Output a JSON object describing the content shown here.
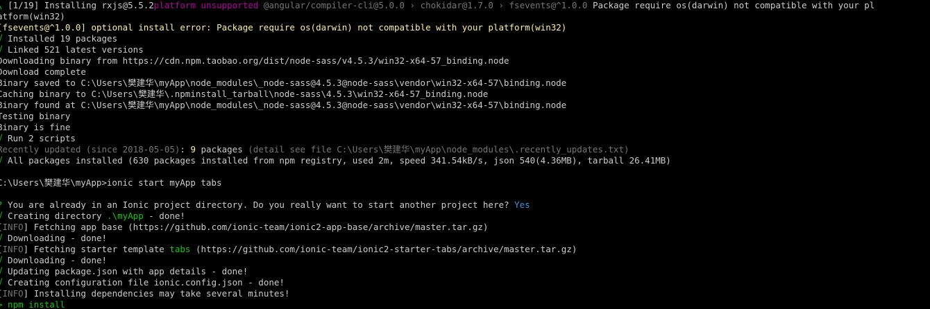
{
  "terminal": {
    "colors": {
      "background": "#000000",
      "default": "#cccccc",
      "green": "#16c60c",
      "yellow": "#f9f1a5",
      "magenta": "#b4009e",
      "gray": "#767676",
      "cyan": "#3a96dd",
      "white": "#f2f2f2"
    },
    "lines": [
      [
        {
          "t": "\\ ",
          "c": "green"
        },
        {
          "t": "[1/19] Installing rxjs@5.5.2",
          "c": "default"
        },
        {
          "t": "platform unsupported",
          "c": "magenta"
        },
        {
          "t": " @angular/compiler-cli@5.0.0 › chokidar@1.7.0 › fsevents@^1.0.0",
          "c": "gray"
        },
        {
          "t": " Package require os(darwin) not compatible with your pl",
          "c": "default"
        }
      ],
      [
        {
          "t": "atform(win32)",
          "c": "default"
        }
      ],
      [
        {
          "t": "[fsevents@^1.0.0] optional install error: Package require os(darwin) not compatible with your platform(win32)",
          "c": "yellow"
        }
      ],
      [
        {
          "t": "√",
          "c": "green"
        },
        {
          "t": " Installed 19 packages",
          "c": "default"
        }
      ],
      [
        {
          "t": "√",
          "c": "green"
        },
        {
          "t": " Linked 521 latest versions",
          "c": "default"
        }
      ],
      [
        {
          "t": "Downloading binary from https://cdn.npm.taobao.org/dist/node-sass/v4.5.3/win32-x64-57_binding.node",
          "c": "default"
        }
      ],
      [
        {
          "t": "Download complete",
          "c": "default"
        }
      ],
      [
        {
          "t": "Binary saved to C:\\Users\\樊建华\\myApp\\node_modules\\_node-sass@4.5.3@node-sass\\vendor\\win32-x64-57\\binding.node",
          "c": "default"
        }
      ],
      [
        {
          "t": "Caching binary to C:\\Users\\樊建华\\.npminstall_tarball\\node-sass\\4.5.3\\win32-x64-57_binding.node",
          "c": "default"
        }
      ],
      [
        {
          "t": "Binary found at C:\\Users\\樊建华\\myApp\\node_modules\\_node-sass@4.5.3@node-sass\\vendor\\win32-x64-57\\binding.node",
          "c": "default"
        }
      ],
      [
        {
          "t": "Testing binary",
          "c": "default"
        }
      ],
      [
        {
          "t": "Binary is fine",
          "c": "default"
        }
      ],
      [
        {
          "t": "√",
          "c": "green"
        },
        {
          "t": " Run 2 scripts",
          "c": "default"
        }
      ],
      [
        {
          "t": "Recently updated (since 2018-05-05)",
          "c": "gray"
        },
        {
          "t": ": ",
          "c": "default"
        },
        {
          "t": "9",
          "c": "yellow"
        },
        {
          "t": " packages ",
          "c": "default"
        },
        {
          "t": "(detail see file C:\\Users\\樊建华\\myApp\\node_modules\\.recently_updates.txt)",
          "c": "gray"
        }
      ],
      [
        {
          "t": "√",
          "c": "green"
        },
        {
          "t": " All packages installed (630 packages installed from npm registry, used 2m, speed 341.54kB/s, json 540(4.36MB), tarball 26.41MB)",
          "c": "default"
        }
      ],
      [],
      [
        {
          "t": "C:\\Users\\樊建华\\myApp>ionic start myApp tabs",
          "c": "default"
        }
      ],
      [],
      [
        {
          "t": "?",
          "c": "green"
        },
        {
          "t": " You are already in an Ionic project directory. Do you really want to start another project here? ",
          "c": "default"
        },
        {
          "t": "Yes",
          "c": "cyan"
        }
      ],
      [
        {
          "t": "√",
          "c": "green"
        },
        {
          "t": " Creating directory ",
          "c": "default"
        },
        {
          "t": ".\\myApp",
          "c": "green"
        },
        {
          "t": " - done!",
          "c": "default"
        }
      ],
      [
        {
          "t": "[",
          "c": "default"
        },
        {
          "t": "INFO",
          "c": "gray"
        },
        {
          "t": "] Fetching app base (https://github.com/ionic-team/ionic2-app-base/archive/master.tar.gz)",
          "c": "default"
        }
      ],
      [
        {
          "t": "√",
          "c": "green"
        },
        {
          "t": " Downloading - done!",
          "c": "default"
        }
      ],
      [
        {
          "t": "[",
          "c": "default"
        },
        {
          "t": "INFO",
          "c": "gray"
        },
        {
          "t": "] Fetching starter template ",
          "c": "default"
        },
        {
          "t": "tabs",
          "c": "green"
        },
        {
          "t": " (https://github.com/ionic-team/ionic2-starter-tabs/archive/master.tar.gz)",
          "c": "default"
        }
      ],
      [
        {
          "t": "√",
          "c": "green"
        },
        {
          "t": " Downloading - done!",
          "c": "default"
        }
      ],
      [
        {
          "t": "√",
          "c": "green"
        },
        {
          "t": " Updating package.json with app details - done!",
          "c": "default"
        }
      ],
      [
        {
          "t": "√",
          "c": "green"
        },
        {
          "t": " Creating configuration file ionic.config.json - done!",
          "c": "default"
        }
      ],
      [
        {
          "t": "[",
          "c": "default"
        },
        {
          "t": "INFO",
          "c": "gray"
        },
        {
          "t": "] Installing dependencies may take several minutes!",
          "c": "default"
        }
      ],
      [
        {
          "t": "> npm install",
          "c": "green"
        }
      ]
    ]
  }
}
